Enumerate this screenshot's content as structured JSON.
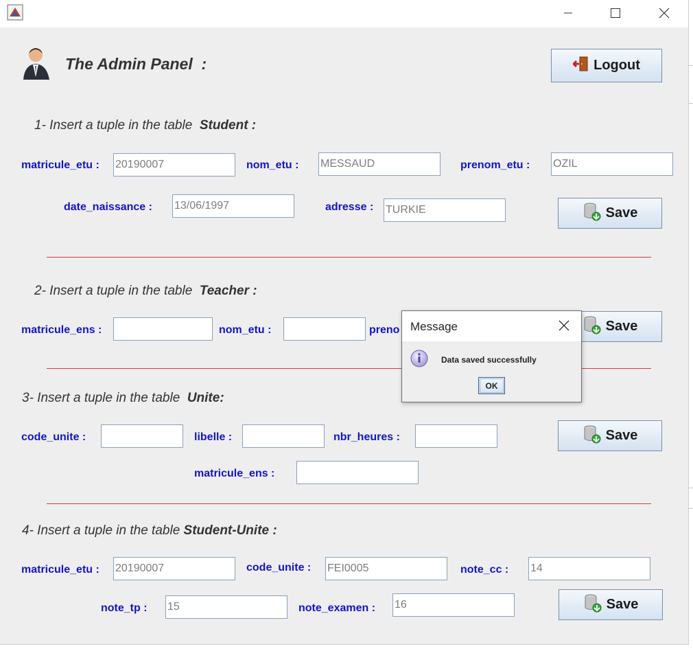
{
  "window": {
    "minimize_glyph": "—",
    "maximize_glyph": "☐",
    "close_glyph": "✕"
  },
  "header": {
    "title": "The Admin Panel  :",
    "logout_label": "Logout"
  },
  "sections": {
    "student": {
      "prefix": "1- Insert a tuple in the table  ",
      "table": "Student :",
      "labels": {
        "matricule": "matricule_etu :",
        "nom": "nom_etu :",
        "prenom": "prenom_etu :",
        "date": "date_naissance :",
        "adresse": "adresse :"
      },
      "values": {
        "matricule": "20190007",
        "nom": "MESSAUD",
        "prenom": "OZIL",
        "date": "13/06/1997",
        "adresse": "TURKIE"
      },
      "save_label": "Save"
    },
    "teacher": {
      "prefix": "2- Insert a tuple in the table  ",
      "table": "Teacher :",
      "labels": {
        "matricule": "matricule_ens :",
        "nom": "nom_etu :",
        "prenom_partial": "preno"
      },
      "values": {
        "matricule": "",
        "nom": ""
      },
      "save_label": "Save"
    },
    "unite": {
      "prefix": "3- Insert a tuple in the table  ",
      "table": "Unite:",
      "labels": {
        "code": "code_unite :",
        "libelle": "libelle :",
        "heures": "nbr_heures :",
        "matricule": "matricule_ens :"
      },
      "values": {
        "code": "",
        "libelle": "",
        "heures": "",
        "matricule": ""
      },
      "save_label": "Save"
    },
    "student_unite": {
      "prefix": "4- Insert a tuple in the table ",
      "table": "Student-Unite :",
      "labels": {
        "matricule": "matricule_etu :",
        "code": "code_unite :",
        "cc": "note_cc :",
        "tp": "note_tp :",
        "examen": "note_examen :"
      },
      "values": {
        "matricule": "20190007",
        "code": "FEI0005",
        "cc": "14",
        "tp": "15",
        "examen": "16"
      },
      "save_label": "Save"
    }
  },
  "dialog": {
    "title": "Message",
    "message": "Data saved successfully",
    "ok_label": "OK"
  },
  "colors": {
    "label": "#1414c8",
    "separator": "#d23c3c",
    "window_bg": "#eeeeee",
    "field_text": "#7d7d7d"
  }
}
